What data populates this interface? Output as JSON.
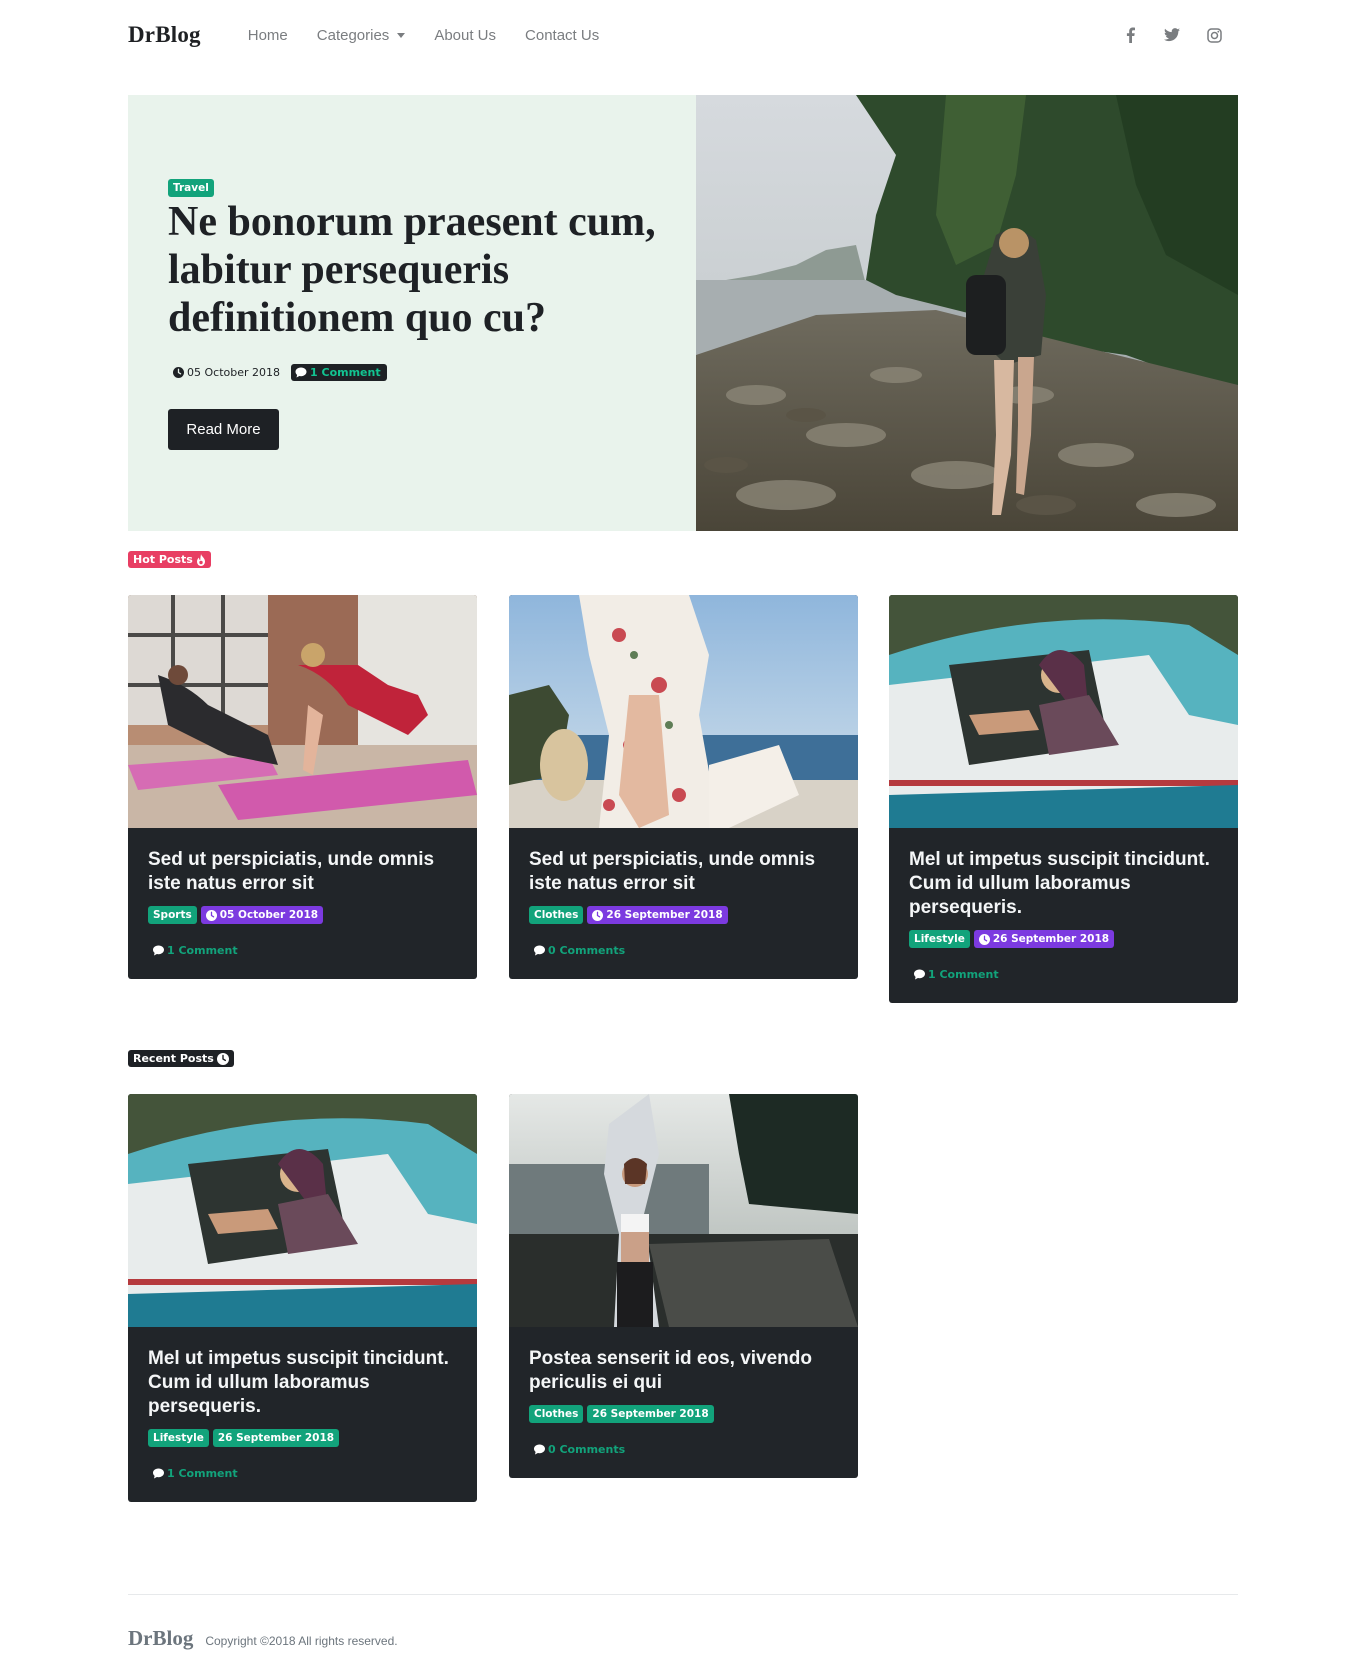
{
  "navbar": {
    "brand": "DrBlog",
    "links": [
      "Home",
      "Categories",
      "About Us",
      "Contact Us"
    ],
    "social": [
      "facebook-icon",
      "twitter-icon",
      "instagram-icon"
    ]
  },
  "hero": {
    "category": "Travel",
    "title": "Ne bonorum praesent cum, labitur persequeris definitionem quo cu?",
    "date": "05 October 2018",
    "comments": "1 Comment",
    "button": "Read More"
  },
  "hot_posts": {
    "label": "Hot Posts",
    "cards": [
      {
        "title": "Sed ut perspiciatis, unde omnis iste natus error sit",
        "category": "Sports",
        "date": "05 October 2018",
        "comments": "1 Comment"
      },
      {
        "title": "Sed ut perspiciatis, unde omnis iste natus error sit",
        "category": "Clothes",
        "date": "26 September 2018",
        "comments": "0 Comments"
      },
      {
        "title": "Mel ut impetus suscipit tincidunt. Cum id ullum laboramus persequeris.",
        "category": "Lifestyle",
        "date": "26 September 2018",
        "comments": "1 Comment"
      }
    ]
  },
  "recent_posts": {
    "label": "Recent Posts",
    "cards": [
      {
        "title": "Mel ut impetus suscipit tincidunt. Cum id ullum laboramus persequeris.",
        "category": "Lifestyle",
        "date": "26 September 2018",
        "comments": "1 Comment"
      },
      {
        "title": "Postea senserit id eos, vivendo periculis ei qui",
        "category": "Clothes",
        "date": "26 September 2018",
        "comments": "0 Comments"
      }
    ]
  },
  "footer": {
    "brand": "DrBlog",
    "copyright": "Copyright ©2018 All rights reserved."
  },
  "colors": {
    "accent_green": "#12a37b",
    "accent_purple": "#7c3ae0",
    "hot_red": "#e83e63",
    "dark": "#212529",
    "hero_bg": "#e9f3ec"
  }
}
